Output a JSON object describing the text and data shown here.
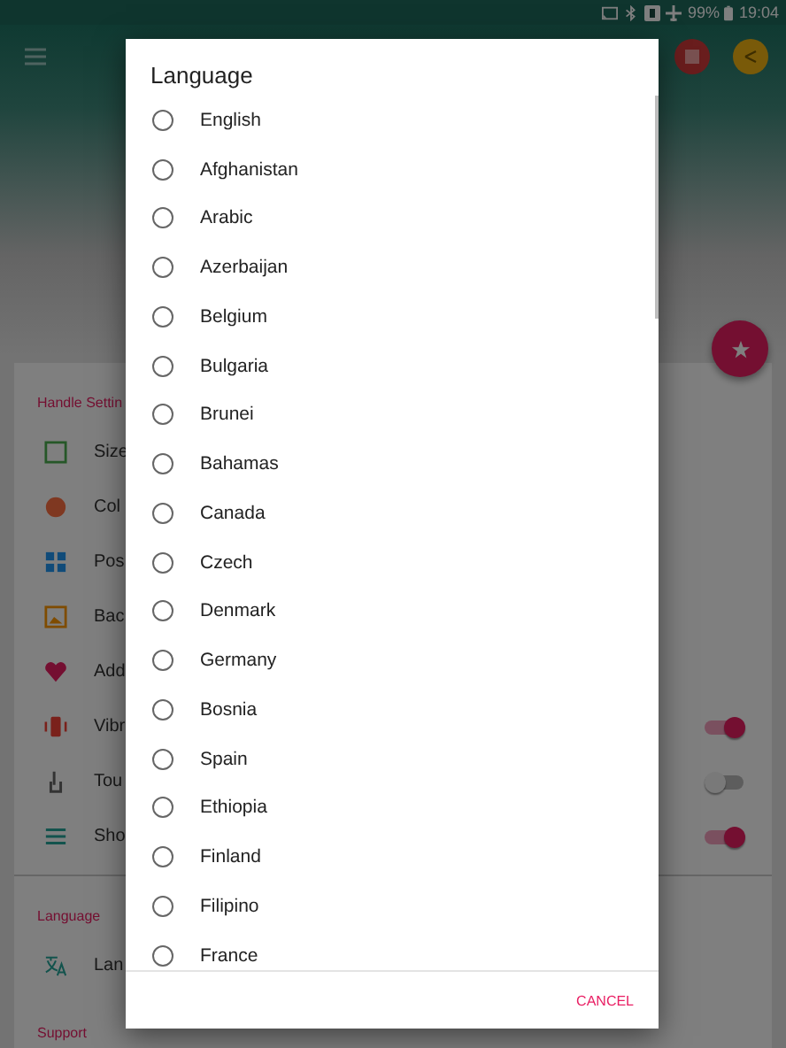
{
  "status_bar": {
    "battery": "99%",
    "time": "19:04"
  },
  "settings": {
    "section_title": "Handle Settin",
    "items": [
      {
        "label": "Size",
        "kind": "plain"
      },
      {
        "label": "Col",
        "kind": "plain"
      },
      {
        "label": "Pos",
        "kind": "plain"
      },
      {
        "label": "Bac",
        "kind": "plain"
      },
      {
        "label": "Add",
        "kind": "plain"
      },
      {
        "label": "Vibr",
        "kind": "toggle",
        "on": true
      },
      {
        "label": "Tou",
        "kind": "toggle",
        "on": false
      },
      {
        "label": "Sho",
        "kind": "toggle",
        "on": true
      }
    ],
    "language_title": "Language",
    "language_item": "Lan",
    "support_title": "Support"
  },
  "dialog": {
    "title": "Language",
    "options": [
      {
        "label": "English",
        "selected": false
      },
      {
        "label": "Afghanistan",
        "selected": false
      },
      {
        "label": "Arabic",
        "selected": false
      },
      {
        "label": "Azerbaijan",
        "selected": false
      },
      {
        "label": "Belgium",
        "selected": false
      },
      {
        "label": "Bulgaria",
        "selected": false
      },
      {
        "label": "Brunei",
        "selected": false
      },
      {
        "label": "Bahamas",
        "selected": false
      },
      {
        "label": "Canada",
        "selected": false
      },
      {
        "label": "Czech",
        "selected": false
      },
      {
        "label": "Denmark",
        "selected": false
      },
      {
        "label": "Germany",
        "selected": false
      },
      {
        "label": "Bosnia",
        "selected": false
      },
      {
        "label": "Spain",
        "selected": false
      },
      {
        "label": "Ethiopia",
        "selected": false
      },
      {
        "label": "Finland",
        "selected": false
      },
      {
        "label": "Filipino",
        "selected": false
      },
      {
        "label": "France",
        "selected": false
      }
    ],
    "cancel": "CANCEL"
  }
}
